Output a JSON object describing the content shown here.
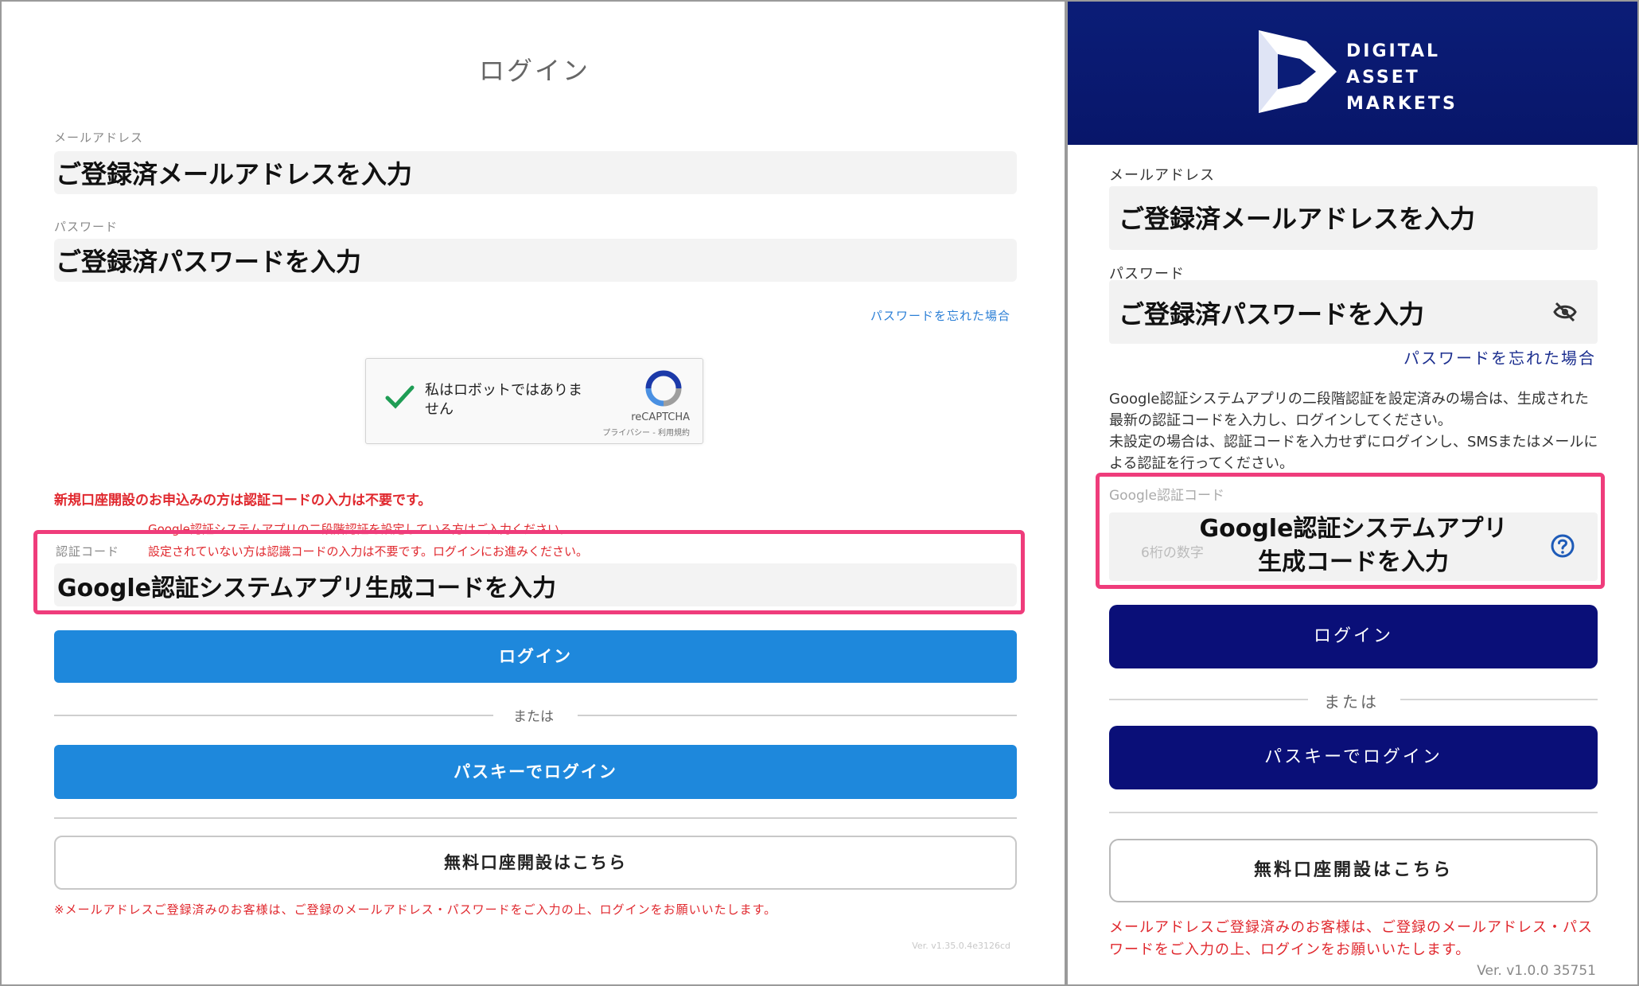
{
  "left": {
    "title": "ログイン",
    "email": {
      "label": "メールアドレス",
      "value": "ご登録済メールアドレスを入力"
    },
    "password": {
      "label": "パスワード",
      "value": "ご登録済パスワードを入力"
    },
    "forgot_link": "パスワードを忘れた場合",
    "captcha": {
      "text": "私はロボットではありません",
      "brand": "reCAPTCHA",
      "terms": "プライバシー - 利用規約"
    },
    "new_account_notice": "新規口座開設のお申込みの方は認証コードの入力は不要です。",
    "auth_notice_line1": "Google認証システムアプリの二段階認証を設定している方はご入力ください。",
    "auth_notice_line2": "設定されていない方は認識コードの入力は不要です。ログインにお進みください。",
    "auth_code": {
      "label": "認証コード",
      "value": "Google認証システムアプリ生成コードを入力"
    },
    "login_button": "ログイン",
    "or_text": "または",
    "passkey_button": "パスキーでログイン",
    "open_account_button": "無料口座開設はこちら",
    "registered_note": "※メールアドレスご登録済みのお客様は、ご登録のメールアドレス・パスワードをご入力の上、ログインをお願いいたします。",
    "version": "Ver. v1.35.0.4e3126cd"
  },
  "right": {
    "brand_lines": [
      "DIGITAL",
      "ASSET",
      "MARKETS"
    ],
    "email": {
      "label": "メールアドレス",
      "value": "ご登録済メールアドレスを入力"
    },
    "password": {
      "label": "パスワード",
      "value": "ご登録済パスワードを入力"
    },
    "forgot_link": "パスワードを忘れた場合",
    "description": "Google認証システムアプリの二段階認証を設定済みの場合は、生成された最新の認証コードを入力し、ログインしてください。\n未設定の場合は、認証コードを入力せずにログインし、SMSまたはメールによる認証を行ってください。",
    "gauth": {
      "label": "Google認証コード",
      "placeholder": "6桁の数字",
      "value_line1": "Google認証システムアプリ",
      "value_line2": "生成コードを入力"
    },
    "login_button": "ログイン",
    "or_text": "または",
    "passkey_button": "パスキーでログイン",
    "open_account_button": "無料口座開設はこちら",
    "registered_note": "メールアドレスご登録済みのお客様は、ご登録のメールアドレス・パスワードをご入力の上、ログインをお願いいたします。",
    "version": "Ver. v1.0.0 35751"
  },
  "colors": {
    "left_button": "#1e88dc",
    "right_button": "#0a0f78",
    "header": "#0b1d77",
    "highlight": "#ef3c7b",
    "notice_red": "#e0282e",
    "link_blue": "#2b7fd6"
  }
}
